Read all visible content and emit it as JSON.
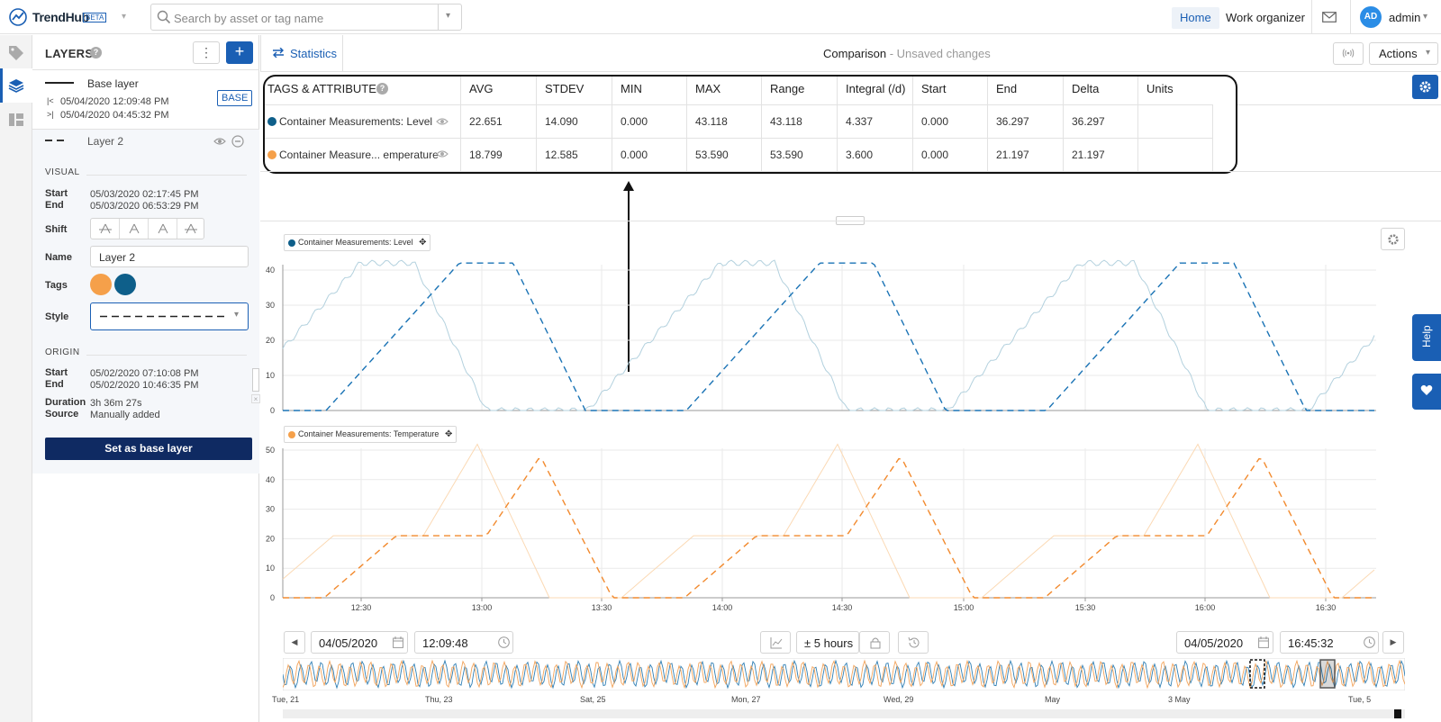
{
  "app": {
    "name": "TrendHub",
    "badge": "BETA"
  },
  "search": {
    "placeholder": "Search by asset or tag name"
  },
  "nav": {
    "home": "Home",
    "work_organizer": "Work organizer",
    "user_initials": "AD",
    "user": "admin"
  },
  "layers_panel": {
    "title": "LAYERS",
    "base_layer": {
      "name": "Base layer",
      "start": "05/04/2020 12:09:48 PM",
      "end": "05/04/2020 04:45:32 PM",
      "badge": "BASE"
    },
    "layer2": {
      "name": "Layer 2",
      "visual_title": "VISUAL",
      "start_label": "Start",
      "start": "05/03/2020 02:17:45 PM",
      "end_label": "End",
      "end": "05/03/2020 06:53:29 PM",
      "shift_label": "Shift",
      "name_label": "Name",
      "name_value": "Layer 2",
      "tags_label": "Tags",
      "style_label": "Style",
      "origin_title": "ORIGIN",
      "origin_start": "05/02/2020 07:10:08 PM",
      "origin_end": "05/02/2020 10:46:35 PM",
      "duration_label": "Duration",
      "duration": "3h 36m 27s",
      "source_label": "Source",
      "source": "Manually added"
    },
    "set_base_button": "Set as base layer"
  },
  "header": {
    "tab": "Statistics",
    "title": "Comparison",
    "subtitle": " - Unsaved changes",
    "actions": "Actions"
  },
  "stats_table": {
    "headers": [
      "TAGS & ATTRIBUTES",
      "AVG",
      "STDEV",
      "MIN",
      "MAX",
      "Range",
      "Integral (/d)",
      "Start",
      "End",
      "Delta",
      "Units"
    ],
    "rows": [
      {
        "tag": "Container Measurements: Level",
        "color": "#0e5f8a",
        "values": [
          "22.651",
          "14.090",
          "0.000",
          "43.118",
          "43.118",
          "4.337",
          "0.000",
          "36.297",
          "36.297",
          ""
        ]
      },
      {
        "tag": "Container Measure... emperature",
        "color": "#f5a04a",
        "values": [
          "18.799",
          "12.585",
          "0.000",
          "53.590",
          "53.590",
          "3.600",
          "0.000",
          "21.197",
          "21.197",
          ""
        ]
      }
    ]
  },
  "charts": {
    "level_legend": "Container Measurements: Level",
    "temp_legend": "Container Measurements: Temperature",
    "level_yticks": [
      "40",
      "30",
      "20",
      "10",
      "0"
    ],
    "temp_yticks": [
      "50",
      "40",
      "30",
      "20",
      "10",
      "0"
    ],
    "xticks": [
      "12:30",
      "13:00",
      "13:30",
      "14:00",
      "14:30",
      "15:00",
      "15:30",
      "16:00",
      "16:30"
    ]
  },
  "time_controls": {
    "start_date": "04/05/2020",
    "start_time": "12:09:48",
    "range": "± 5 hours",
    "end_date": "04/05/2020",
    "end_time": "16:45:32"
  },
  "overview_ticks": [
    "Tue, 21",
    "Thu, 23",
    "Sat, 25",
    "Mon, 27",
    "Wed, 29",
    "May",
    "3 May",
    "Tue, 5"
  ],
  "side_tabs": {
    "help": "Help"
  },
  "colors": {
    "accent": "#1a5fb4",
    "level": "#0e5f8a",
    "temperature": "#f5a04a",
    "dark_button": "#0f2a62"
  }
}
